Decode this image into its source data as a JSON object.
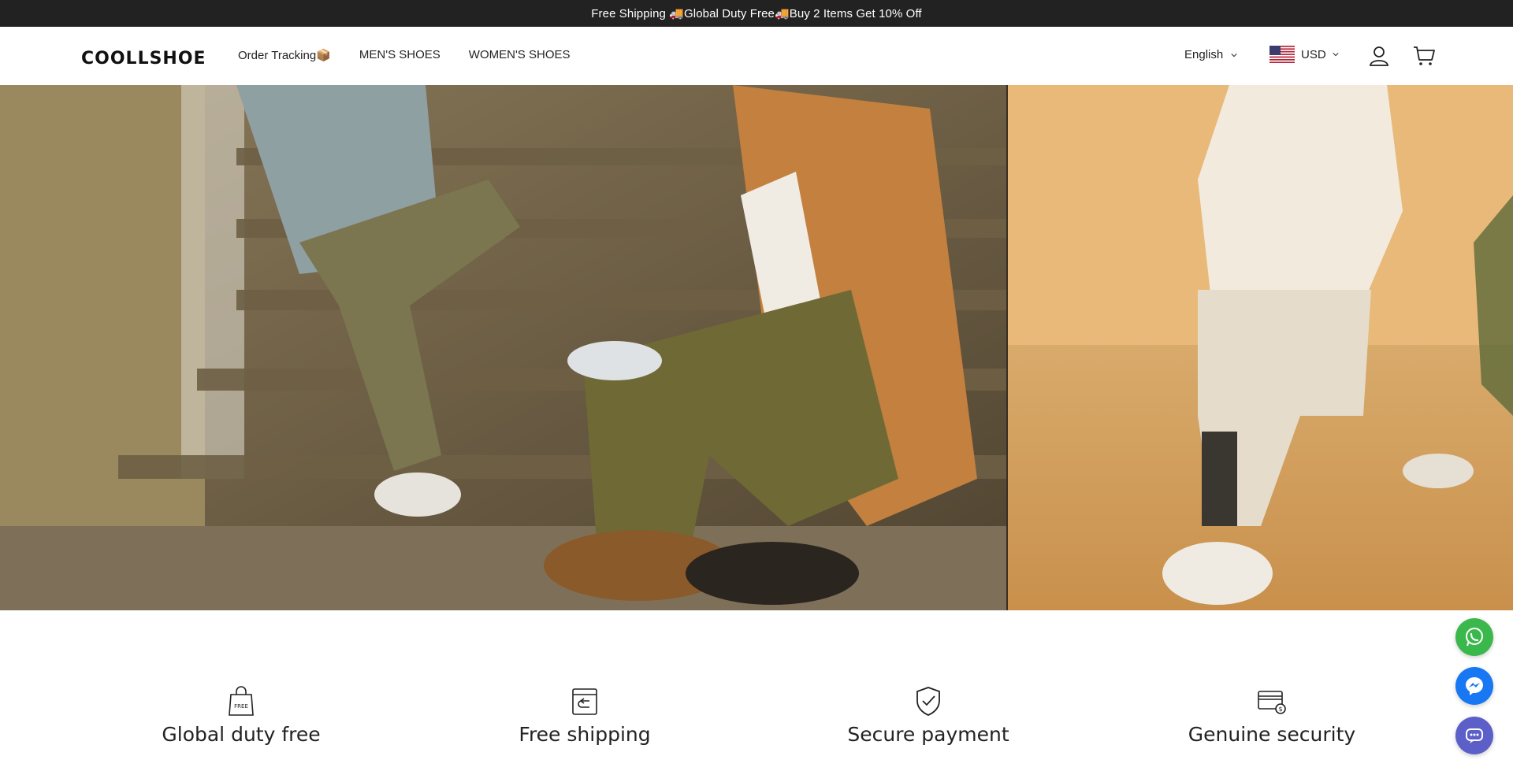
{
  "announcement": {
    "text": "Free Shipping 🚚Global Duty Free🚚Buy 2 Items Get 10% Off"
  },
  "header": {
    "logo": "COOLLSHOE",
    "nav": [
      {
        "label": "Order Tracking📦"
      },
      {
        "label": "MEN'S SHOES"
      },
      {
        "label": "WOMEN'S SHOES"
      }
    ],
    "language": "English",
    "currency": "USD",
    "icons": {
      "user": "user-icon",
      "cart": "cart-icon",
      "flag": "us-flag-icon"
    }
  },
  "hero": {
    "image_left": "hero-men-on-stairs",
    "image_right": "hero-woman-desert"
  },
  "features": [
    {
      "title": "Global duty free",
      "icon": "free-bag-icon"
    },
    {
      "title": "Free shipping",
      "icon": "shipping-box-icon"
    },
    {
      "title": "Secure payment",
      "icon": "shield-check-icon"
    },
    {
      "title": "Genuine security",
      "icon": "card-dollar-icon"
    }
  ],
  "floating": {
    "whatsapp": "whatsapp-icon",
    "messenger": "messenger-icon",
    "chat": "chat-icon"
  },
  "colors": {
    "announcement_bg": "#222222",
    "whatsapp": "#3bb84c",
    "messenger": "#1877f2",
    "chat": "#5b5fc7"
  }
}
